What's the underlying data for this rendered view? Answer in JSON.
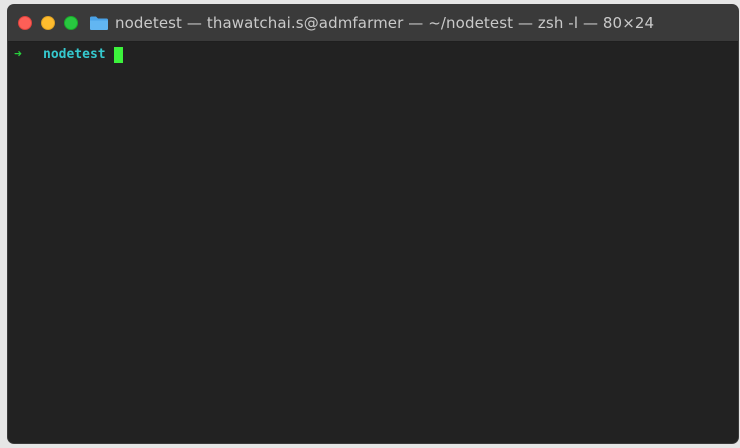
{
  "window": {
    "title": "nodetest — thawatchai.s@admfarmer — ~/nodetest — zsh -l — 80×24",
    "folder_icon": "folder-icon",
    "controls": [
      "close",
      "minimize",
      "maximize"
    ],
    "colors": {
      "close": "#fe5f57",
      "minimize": "#febc2e",
      "maximize": "#28c840",
      "background": "#222222"
    }
  },
  "terminal": {
    "prompt_symbol": "➜",
    "directory": "nodetest",
    "input": "",
    "colors": {
      "prompt": "#27d13c",
      "directory": "#35c9cf",
      "cursor": "#3cf23c"
    }
  }
}
